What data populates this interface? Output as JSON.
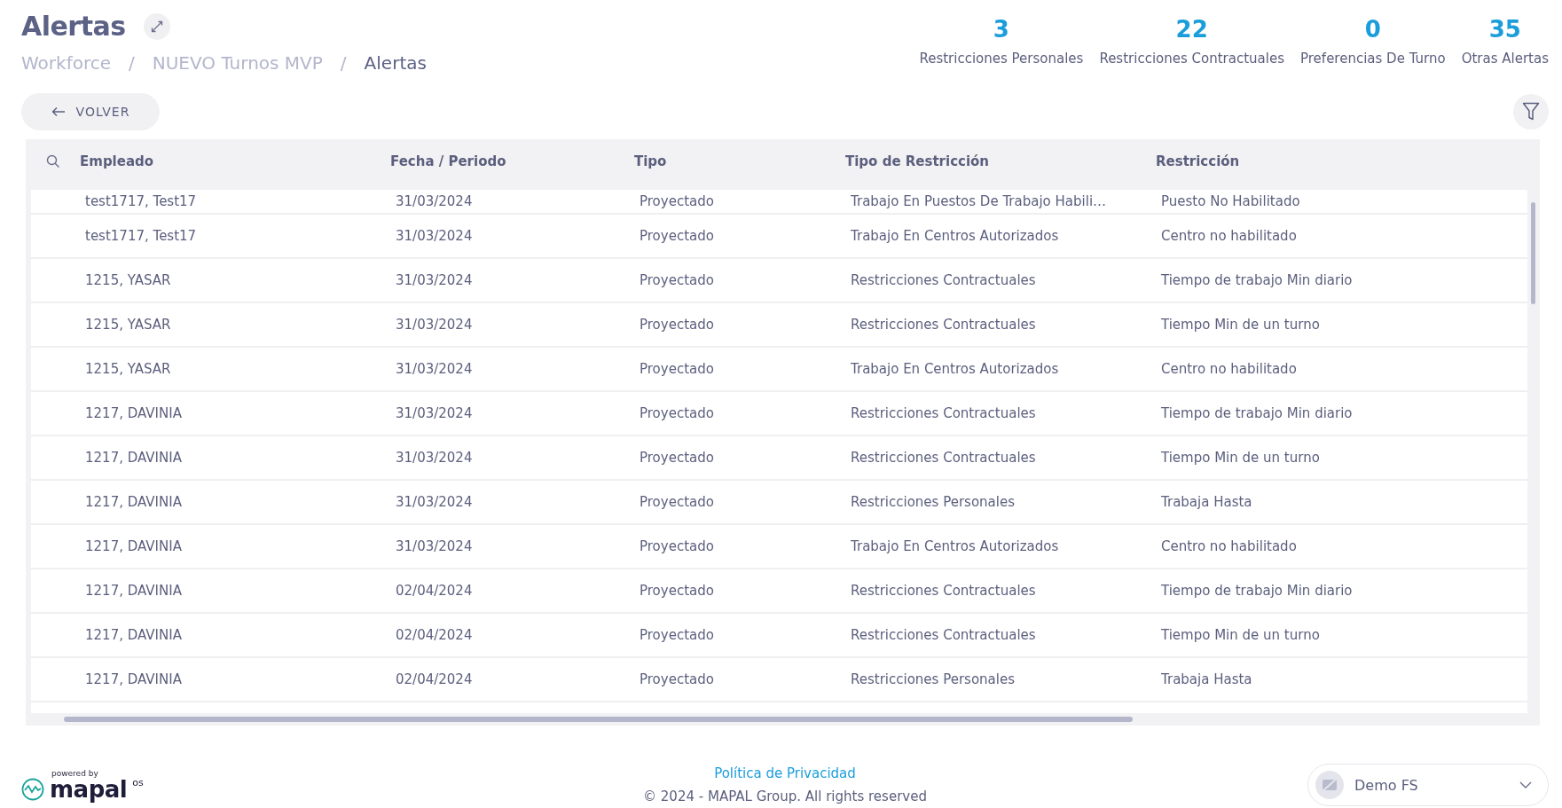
{
  "header": {
    "title": "Alertas",
    "breadcrumbs": [
      {
        "label": "Workforce",
        "current": false
      },
      {
        "label": "NUEVO Turnos MVP",
        "current": false
      },
      {
        "label": "Alertas",
        "current": true
      }
    ],
    "separator": "/"
  },
  "stats": [
    {
      "value": "3",
      "label": "Restricciones Personales"
    },
    {
      "value": "22",
      "label": "Restricciones Contractuales"
    },
    {
      "value": "0",
      "label": "Preferencias De Turno"
    },
    {
      "value": "35",
      "label": "Otras Alertas"
    }
  ],
  "back_button": {
    "label": "VOLVER"
  },
  "table": {
    "columns": [
      "Empleado",
      "Fecha / Periodo",
      "Tipo",
      "Tipo de Restricción",
      "Restricción"
    ],
    "rows": [
      [
        "test1717, Test17",
        "31/03/2024",
        "Proyectado",
        "Trabajo En Puestos De Trabajo Habili…",
        "Puesto No Habilitado"
      ],
      [
        "test1717, Test17",
        "31/03/2024",
        "Proyectado",
        "Trabajo En Centros Autorizados",
        "Centro no habilitado"
      ],
      [
        "1215, YASAR",
        "31/03/2024",
        "Proyectado",
        "Restricciones Contractuales",
        "Tiempo de trabajo Min diario"
      ],
      [
        "1215, YASAR",
        "31/03/2024",
        "Proyectado",
        "Restricciones Contractuales",
        "Tiempo Min de un turno"
      ],
      [
        "1215, YASAR",
        "31/03/2024",
        "Proyectado",
        "Trabajo En Centros Autorizados",
        "Centro no habilitado"
      ],
      [
        "1217, DAVINIA",
        "31/03/2024",
        "Proyectado",
        "Restricciones Contractuales",
        "Tiempo de trabajo Min diario"
      ],
      [
        "1217, DAVINIA",
        "31/03/2024",
        "Proyectado",
        "Restricciones Contractuales",
        "Tiempo Min de un turno"
      ],
      [
        "1217, DAVINIA",
        "31/03/2024",
        "Proyectado",
        "Restricciones Personales",
        "Trabaja Hasta"
      ],
      [
        "1217, DAVINIA",
        "31/03/2024",
        "Proyectado",
        "Trabajo En Centros Autorizados",
        "Centro no habilitado"
      ],
      [
        "1217, DAVINIA",
        "02/04/2024",
        "Proyectado",
        "Restricciones Contractuales",
        "Tiempo de trabajo Min diario"
      ],
      [
        "1217, DAVINIA",
        "02/04/2024",
        "Proyectado",
        "Restricciones Contractuales",
        "Tiempo Min de un turno"
      ],
      [
        "1217, DAVINIA",
        "02/04/2024",
        "Proyectado",
        "Restricciones Personales",
        "Trabaja Hasta"
      ]
    ]
  },
  "footer": {
    "logo": {
      "tagline": "powered by",
      "wordmark": "mapal",
      "suffix": "os"
    },
    "privacy_link": "Política de Privacidad",
    "copyright": "© 2024 - MAPAL Group. All rights reserved",
    "account": {
      "label": "Demo FS"
    }
  }
}
